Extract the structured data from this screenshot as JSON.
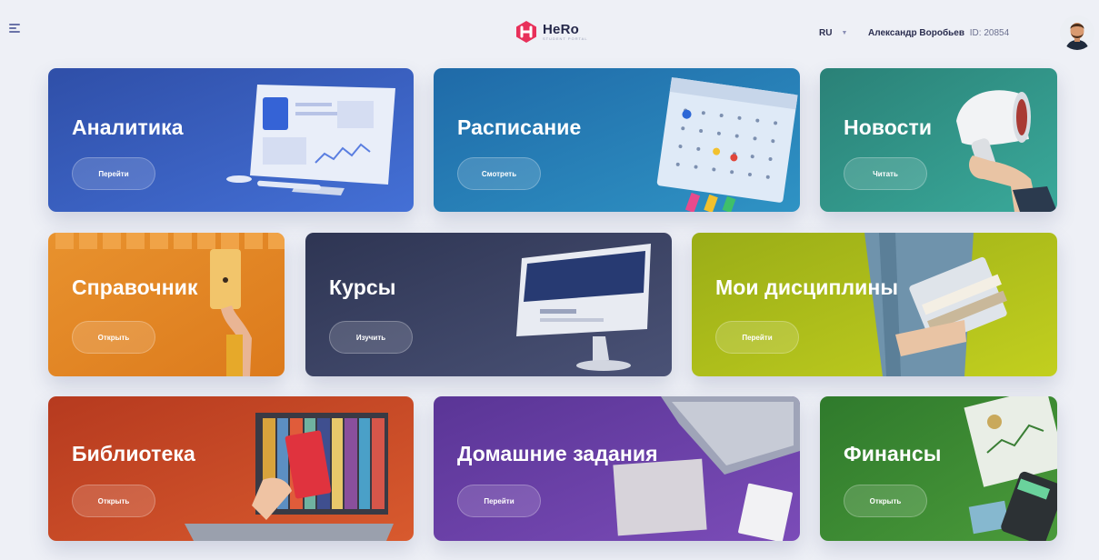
{
  "header": {
    "logo_name": "HeRo",
    "logo_sub": "STUDENT PORTAL",
    "language": "RU",
    "user_name": "Александр Воробьев",
    "user_id": "ID: 20854"
  },
  "colors": {
    "analytics": "#3553ad",
    "schedule": "#2e7ab0",
    "news": "#2f8f86",
    "reference": "#e08424",
    "courses": "#3b4266",
    "disciplines": "#a7b71a",
    "library": "#c34a26",
    "homework": "#6a3fa5",
    "finance": "#3f8a35"
  },
  "cards": [
    {
      "title": "Аналитика",
      "button": "Перейти"
    },
    {
      "title": "Расписание",
      "button": "Смотреть"
    },
    {
      "title": "Новости",
      "button": "Читать"
    },
    {
      "title": "Справочник",
      "button": "Открыть"
    },
    {
      "title": "Курсы",
      "button": "Изучить"
    },
    {
      "title": "Мои дисциплины",
      "button": "Перейти"
    },
    {
      "title": "Библиотека",
      "button": "Открыть"
    },
    {
      "title": "Домашние задания",
      "button": "Перейти"
    },
    {
      "title": "Финансы",
      "button": "Открыть"
    }
  ]
}
